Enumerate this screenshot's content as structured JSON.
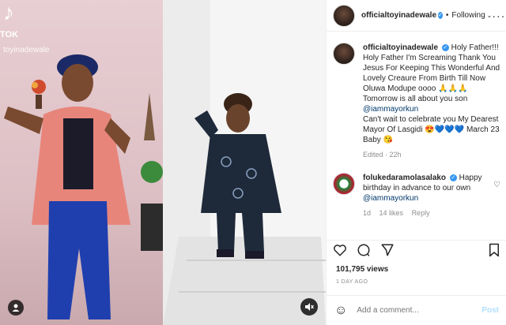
{
  "media": {
    "watermark_logo": "♪",
    "watermark_text": "TOK",
    "watermark_handle": "toyinadewale",
    "colors": {
      "woman_top": "#e8857b",
      "trousers": "#1f3fae",
      "hoodie": "#1e2a3a"
    }
  },
  "header": {
    "username": "officialtoyinadewale",
    "follow_label": "Following"
  },
  "caption": {
    "username": "officialtoyinadewale",
    "text": "Holy Father!!! Holy Father I'm Screaming Thank You Jesus For Keeping This Wonderful And Lovely Creaure From Birth Till Now Oluwa Modupe oooo 🙏🙏🙏 Tomorrow is all about you son",
    "mention": "@iammayorkun",
    "text2": "Can't wait to celebrate you My Dearest Mayor Of Lasgidi 😍💙💙💙 March 23 Baby 😘",
    "edited": "Edited · 22h"
  },
  "comment": {
    "username": "folukedaramolasalako",
    "text": "Happy birthday in advance to our own",
    "mention": "@iammayorkun",
    "time": "1d",
    "likes": "14 likes",
    "reply": "Reply"
  },
  "stats": {
    "likes": "101,795 views",
    "date": "1 DAY AGO"
  },
  "add_comment": {
    "placeholder": "Add a comment...",
    "post_label": "Post"
  }
}
